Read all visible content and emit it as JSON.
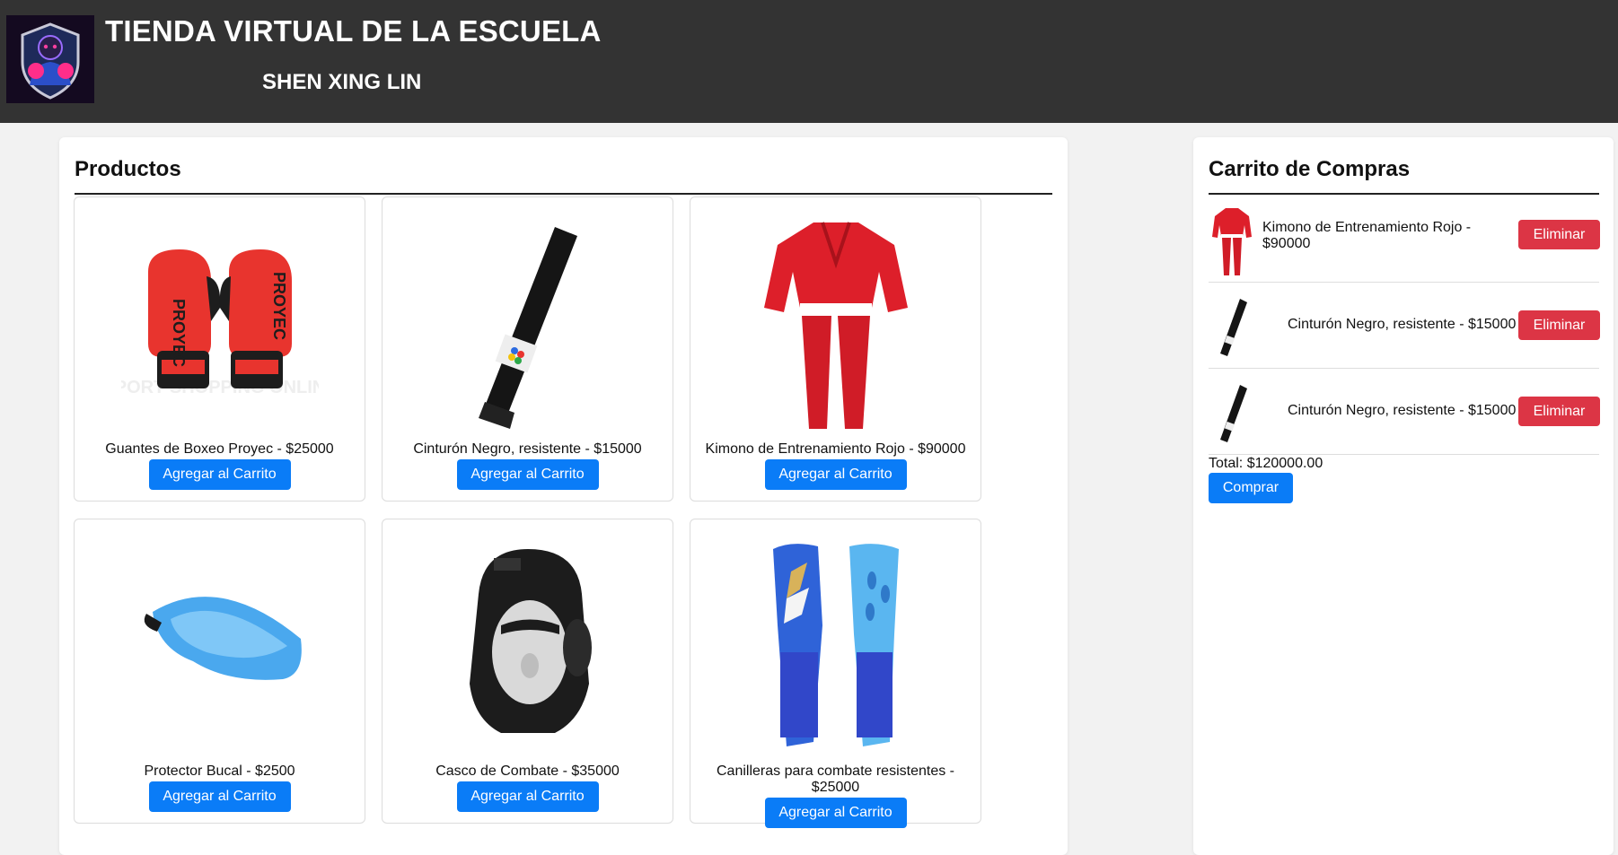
{
  "header": {
    "title": "TIENDA VIRTUAL DE LA ESCUELA",
    "subtitle": "SHEN XING LIN"
  },
  "products": {
    "heading": "Productos",
    "add_button_label": "Agregar al Carrito",
    "items": [
      {
        "label": "Guantes de Boxeo Proyec - $25000",
        "image": "boxing-gloves",
        "watermark": "SPORT SHOPPING ONLINE"
      },
      {
        "label": "Cinturón Negro, resistente - $15000",
        "image": "black-belt"
      },
      {
        "label": "Kimono de Entrenamiento Rojo - $90000",
        "image": "red-kimono"
      },
      {
        "label": "Protector Bucal - $2500",
        "image": "mouthguard"
      },
      {
        "label": "Casco de Combate - $35000",
        "image": "combat-helmet"
      },
      {
        "label": "Canilleras para combate resistentes - $25000",
        "image": "shin-guards"
      }
    ]
  },
  "cart": {
    "heading": "Carrito de Compras",
    "remove_label": "Eliminar",
    "items": [
      {
        "label": "Kimono de Entrenamiento Rojo - $90000",
        "image": "red-kimono"
      },
      {
        "label": "Cinturón Negro, resistente - $15000",
        "image": "black-belt"
      },
      {
        "label": "Cinturón Negro, resistente - $15000",
        "image": "black-belt"
      }
    ],
    "total": "Total: $120000.00",
    "buy_label": "Comprar"
  },
  "colors": {
    "header_bg": "#333333",
    "primary_button": "#0a7cf7",
    "danger_button": "#dc3545",
    "page_bg": "#f2f2f2"
  }
}
